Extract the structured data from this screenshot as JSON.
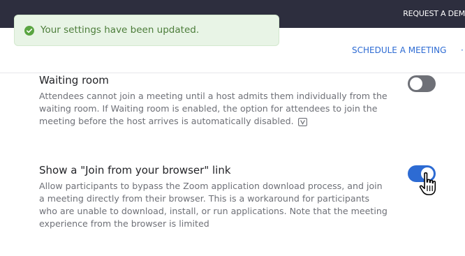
{
  "header": {
    "request_demo": "REQUEST A DEM",
    "schedule_meeting": "SCHEDULE A MEETING"
  },
  "toast": {
    "message": "Your settings have been updated.",
    "icon": "check-circle-icon"
  },
  "settings": [
    {
      "title": "Waiting room",
      "description": "Attendees cannot join a meeting until a host admits them individually from the waiting room. If Waiting room is enabled, the option for attendees to join the meeting before the host arrives is automatically disabled.",
      "enabled": false
    },
    {
      "title": "Show a \"Join from your browser\" link",
      "description": "Allow participants to bypass the Zoom application download process, and join a meeting directly from their browser. This is a workaround for participants who are unable to download, install, or run applications. Note that the meeting experience from the browser is limited",
      "enabled": true
    }
  ],
  "colors": {
    "accent": "#2d6bd3",
    "topbar": "#2d2e3e",
    "toast_bg": "#e8f4e6",
    "toast_text": "#4c7d3a",
    "toggle_off": "#6e7077"
  }
}
